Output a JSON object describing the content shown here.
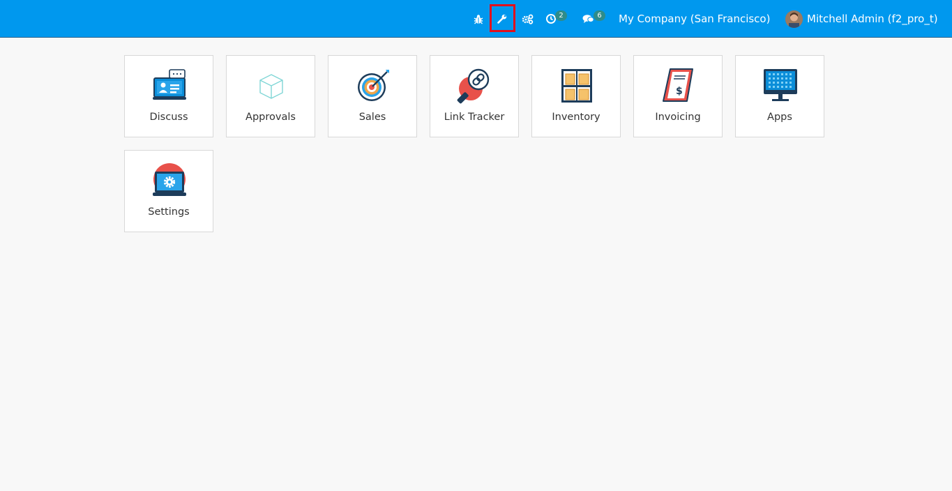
{
  "topbar": {
    "debug_icon": "bug-icon",
    "developer_tools_icon": "wrench-icon",
    "settings_icon": "gears-icon",
    "activity_icon": "clock-icon",
    "activity_count": "2",
    "messages_icon": "comments-icon",
    "messages_count": "6",
    "company": "My Company (San Francisco)",
    "user_name": "Mitchell Admin (f2_pro_t)",
    "highlight_color": "#e3101c",
    "bar_color": "#0098ee"
  },
  "apps": [
    {
      "label": "Discuss",
      "icon": "discuss-icon"
    },
    {
      "label": "Approvals",
      "icon": "approvals-icon"
    },
    {
      "label": "Sales",
      "icon": "sales-icon"
    },
    {
      "label": "Link Tracker",
      "icon": "link-tracker-icon"
    },
    {
      "label": "Inventory",
      "icon": "inventory-icon"
    },
    {
      "label": "Invoicing",
      "icon": "invoicing-icon"
    },
    {
      "label": "Apps",
      "icon": "apps-icon"
    },
    {
      "label": "Settings",
      "icon": "settings-icon"
    }
  ]
}
